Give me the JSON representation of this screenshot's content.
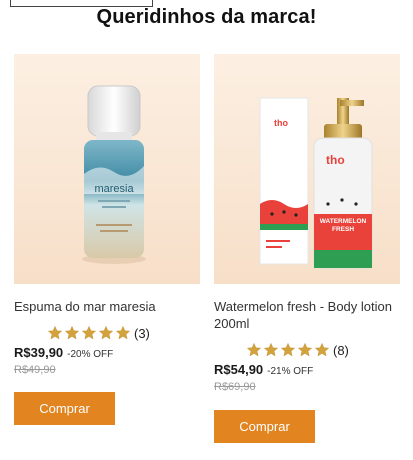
{
  "section": {
    "title": "Queridinhos da marca!"
  },
  "products": [
    {
      "name": "Espuma do mar maresia",
      "image_label": "maresia",
      "rating": 5,
      "rating_count": "(3)",
      "price": "R$39,90",
      "discount": "-20% OFF",
      "old_price": "R$49,90",
      "buy_label": "Comprar"
    },
    {
      "name": "Watermelon fresh - Body lotion 200ml",
      "image_brand": "tho",
      "image_label": "WATERMELON FRESH",
      "rating": 5,
      "rating_count": "(8)",
      "price": "R$54,90",
      "discount": "-21% OFF",
      "old_price": "R$69,90",
      "buy_label": "Comprar"
    }
  ],
  "colors": {
    "accent": "#e28420",
    "star": "#d4a23a",
    "image_bg": "#fbe9d8"
  },
  "icons": {
    "rating": "star-icon"
  }
}
